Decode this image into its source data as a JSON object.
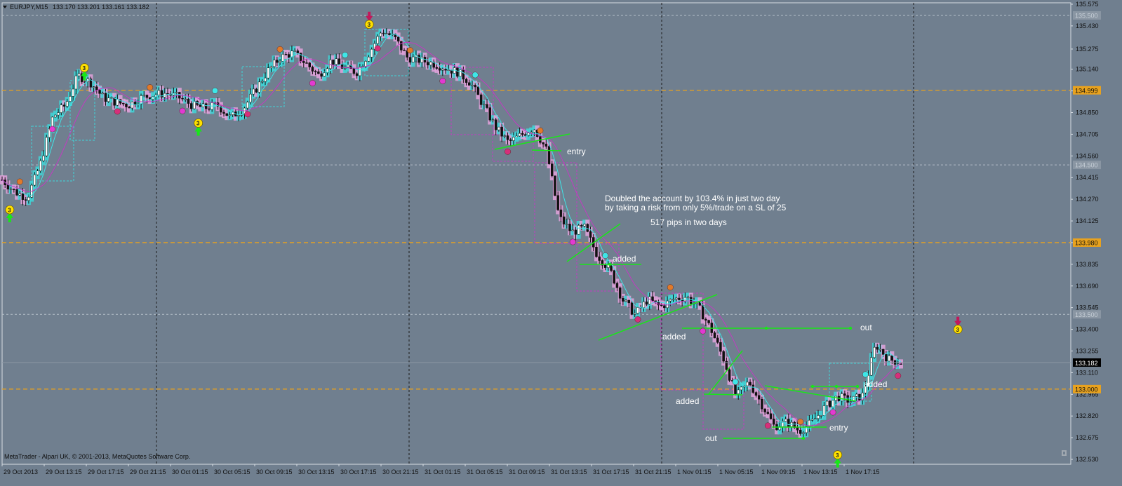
{
  "header": {
    "dropdown_icon": "chevron-down-icon",
    "symbol": "EURJPY,M15",
    "ohlc": "133.170 133.201 133.161 133.182"
  },
  "footer": {
    "copyright": "MetaTrader - Alpari UK, © 2001-2013, MetaQuotes Software Corp."
  },
  "colors": {
    "background": "#707f8f",
    "bull_box": "#40d6d8",
    "bear_box": "#e2a2dc",
    "level_line": "#e8a21e",
    "trend_line": "#19e619",
    "fast_ma": "#3ee6e8",
    "slow_ma": "#c13cc1",
    "current_price_tag": "#000000"
  },
  "annotations": {
    "main_line1": "Doubled the account by 103.4% in just two day",
    "main_line2": "by taking a risk from only 5%/trade on a SL of 25",
    "pips_note": "517 pips in two days",
    "entry_1": "entry",
    "added_1": "added",
    "added_2": "added",
    "added_3": "added",
    "added_4": "added",
    "entry_2": "entry",
    "out_1": "out",
    "out_2": "out"
  },
  "chart_data": {
    "type": "candlestick",
    "symbol": "EURJPY",
    "timeframe": "M15",
    "price_axis_labels": [
      "135.575",
      "135.430",
      "135.275",
      "135.140",
      "134.995",
      "134.850",
      "134.705",
      "134.560",
      "134.415",
      "134.270",
      "134.125",
      "133.980",
      "133.835",
      "133.690",
      "133.545",
      "133.400",
      "133.255",
      "133.110",
      "132.965",
      "132.820",
      "132.675",
      "132.530"
    ],
    "time_axis_labels": [
      "29 Oct 2013",
      "29 Oct 13:15",
      "29 Oct 17:15",
      "29 Oct 21:15",
      "30 Oct 01:15",
      "30 Oct 05:15",
      "30 Oct 09:15",
      "30 Oct 13:15",
      "30 Oct 17:15",
      "30 Oct 21:15",
      "31 Oct 01:15",
      "31 Oct 05:15",
      "31 Oct 09:15",
      "31 Oct 13:15",
      "31 Oct 17:15",
      "31 Oct 21:15",
      "1 Nov 01:15",
      "1 Nov 05:15",
      "1 Nov 09:15",
      "1 Nov 13:15",
      "1 Nov 17:15"
    ],
    "current_price": "133.182",
    "y_range": [
      132.53,
      135.575
    ],
    "horizontal_levels": [
      {
        "price": 135.5,
        "label": "135.500",
        "style": "grey-dashed"
      },
      {
        "price": 134.999,
        "label": "134.999",
        "style": "orange-dashed"
      },
      {
        "price": 134.5,
        "label": "134.500",
        "style": "grey-dashed"
      },
      {
        "price": 133.98,
        "label": "133.980",
        "style": "orange-dashed"
      },
      {
        "price": 133.5,
        "label": "133.500",
        "style": "grey-dashed"
      },
      {
        "price": 133.0,
        "label": "133.000",
        "style": "orange-dashed"
      }
    ],
    "session_separators": [
      "29 Oct 21:15",
      "30 Oct 21:15",
      "31 Oct 21:15",
      "1 Nov 21:15"
    ],
    "arrow_signals": [
      {
        "time_index": 0.06,
        "price": 134.2,
        "digit": "3",
        "dir": "up"
      },
      {
        "time_index": 0.65,
        "price": 135.15,
        "digit": "3",
        "dir": "up"
      },
      {
        "time_index": 1.55,
        "price": 134.78,
        "digit": "3",
        "dir": "up"
      },
      {
        "time_index": 2.9,
        "price": 135.44,
        "digit": "3",
        "dir": "down"
      },
      {
        "time_index": 6.6,
        "price": 132.56,
        "digit": "3",
        "dir": "up"
      },
      {
        "time_index": 7.55,
        "price": 133.4,
        "digit": "3",
        "dir": "down"
      }
    ],
    "close_path": [
      [
        0,
        134.4
      ],
      [
        0.1,
        134.32
      ],
      [
        0.2,
        134.28
      ],
      [
        0.3,
        134.5
      ],
      [
        0.4,
        134.82
      ],
      [
        0.5,
        134.9
      ],
      [
        0.6,
        135.1
      ],
      [
        0.7,
        135.05
      ],
      [
        0.8,
        134.95
      ],
      [
        0.9,
        134.92
      ],
      [
        1.0,
        134.9
      ],
      [
        1.1,
        134.95
      ],
      [
        1.2,
        134.97
      ],
      [
        1.3,
        134.98
      ],
      [
        1.4,
        134.95
      ],
      [
        1.5,
        134.9
      ],
      [
        1.6,
        134.88
      ],
      [
        1.7,
        134.9
      ],
      [
        1.8,
        134.82
      ],
      [
        1.9,
        134.87
      ],
      [
        2.0,
        135.0
      ],
      [
        2.1,
        135.13
      ],
      [
        2.2,
        135.22
      ],
      [
        2.3,
        135.25
      ],
      [
        2.4,
        135.18
      ],
      [
        2.5,
        135.1
      ],
      [
        2.6,
        135.2
      ],
      [
        2.7,
        135.15
      ],
      [
        2.8,
        135.12
      ],
      [
        2.9,
        135.25
      ],
      [
        3.0,
        135.4
      ],
      [
        3.1,
        135.35
      ],
      [
        3.2,
        135.22
      ],
      [
        3.3,
        135.2
      ],
      [
        3.4,
        135.18
      ],
      [
        3.5,
        135.15
      ],
      [
        3.6,
        135.12
      ],
      [
        3.7,
        135.05
      ],
      [
        3.8,
        134.9
      ],
      [
        3.9,
        134.75
      ],
      [
        4.0,
        134.65
      ],
      [
        4.1,
        134.7
      ],
      [
        4.2,
        134.75
      ],
      [
        4.3,
        134.6
      ],
      [
        4.4,
        134.15
      ],
      [
        4.5,
        134.05
      ],
      [
        4.6,
        134.08
      ],
      [
        4.7,
        133.9
      ],
      [
        4.8,
        133.8
      ],
      [
        4.9,
        133.6
      ],
      [
        5.0,
        133.5
      ],
      [
        5.1,
        133.6
      ],
      [
        5.2,
        133.55
      ],
      [
        5.3,
        133.6
      ],
      [
        5.4,
        133.62
      ],
      [
        5.5,
        133.55
      ],
      [
        5.6,
        133.4
      ],
      [
        5.7,
        133.2
      ],
      [
        5.8,
        132.95
      ],
      [
        5.9,
        133.05
      ],
      [
        6.0,
        132.9
      ],
      [
        6.1,
        132.75
      ],
      [
        6.2,
        132.78
      ],
      [
        6.3,
        132.72
      ],
      [
        6.4,
        132.78
      ],
      [
        6.5,
        132.88
      ],
      [
        6.6,
        132.95
      ],
      [
        6.7,
        132.92
      ],
      [
        6.8,
        132.96
      ],
      [
        6.9,
        133.3
      ],
      [
        7.0,
        133.2
      ],
      [
        7.1,
        133.18
      ]
    ]
  }
}
